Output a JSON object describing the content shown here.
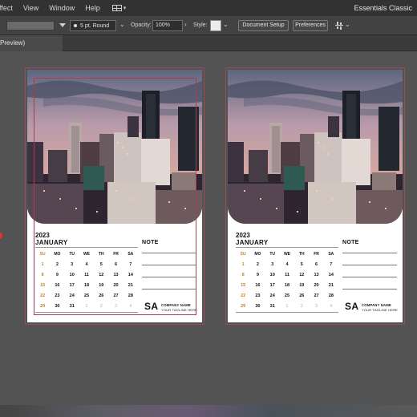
{
  "menu": {
    "items": [
      "ffect",
      "View",
      "Window",
      "Help"
    ],
    "workspace": "Essentials Classic"
  },
  "controlbar": {
    "stroke_profile": "5 pt. Round",
    "opacity_label": "Opacity:",
    "opacity_value": "100%",
    "style_label": "Style:",
    "document_setup": "Document Setup",
    "preferences": "Preferences"
  },
  "doc_tab": {
    "label": "Preview)"
  },
  "calendar": {
    "year": "2023",
    "month": "JANUARY",
    "weekdays": [
      "SU",
      "MO",
      "TU",
      "WE",
      "TH",
      "FR",
      "SA"
    ],
    "weeks": [
      [
        "1",
        "2",
        "3",
        "4",
        "5",
        "6",
        "7"
      ],
      [
        "8",
        "9",
        "10",
        "11",
        "12",
        "13",
        "14"
      ],
      [
        "15",
        "16",
        "17",
        "18",
        "19",
        "20",
        "21"
      ],
      [
        "22",
        "23",
        "24",
        "25",
        "26",
        "27",
        "28"
      ],
      [
        "29",
        "30",
        "31",
        "1",
        "2",
        "3",
        "4"
      ]
    ],
    "note_title": "NOTE",
    "brand": "SA",
    "company_name": "COMPANY NAME",
    "tagline": "YOUR TAGLINE HERE"
  },
  "colors": {
    "artboard_selection": "#a4404f",
    "sunday_accent": "#c4842a",
    "ui_dark": "#323232",
    "canvas": "#535353"
  }
}
